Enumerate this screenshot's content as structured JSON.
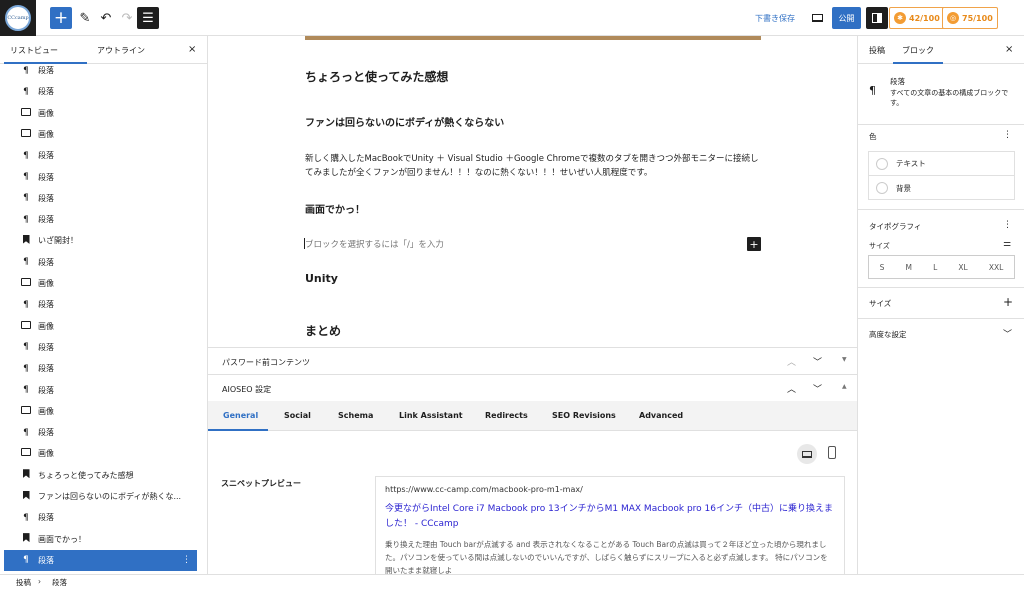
{
  "toolbar": {
    "site_logo_text": "CCcamp",
    "add_icon": "plus-icon",
    "edit_icon": "pencil-icon",
    "undo_icon": "undo-icon",
    "redo_icon": "redo-icon",
    "list_view_icon": "list-view-icon",
    "save_draft": "下書き保存",
    "preview_icon": "preview-icon",
    "publish": "公開",
    "settings_icon": "settings-icon",
    "score1": "42/100",
    "score2": "75/100"
  },
  "left_panel": {
    "tabs": [
      "リストビュー",
      "アウトライン"
    ],
    "close": "×",
    "items": [
      {
        "type": "paragraph",
        "label": "段落"
      },
      {
        "type": "paragraph",
        "label": "段落"
      },
      {
        "type": "image",
        "label": "画像"
      },
      {
        "type": "image",
        "label": "画像"
      },
      {
        "type": "paragraph",
        "label": "段落"
      },
      {
        "type": "paragraph",
        "label": "段落"
      },
      {
        "type": "paragraph",
        "label": "段落"
      },
      {
        "type": "paragraph",
        "label": "段落"
      },
      {
        "type": "heading",
        "label": "いざ開封！"
      },
      {
        "type": "paragraph",
        "label": "段落"
      },
      {
        "type": "image",
        "label": "画像"
      },
      {
        "type": "paragraph",
        "label": "段落"
      },
      {
        "type": "image",
        "label": "画像"
      },
      {
        "type": "paragraph",
        "label": "段落"
      },
      {
        "type": "paragraph",
        "label": "段落"
      },
      {
        "type": "paragraph",
        "label": "段落"
      },
      {
        "type": "image",
        "label": "画像"
      },
      {
        "type": "paragraph",
        "label": "段落"
      },
      {
        "type": "image",
        "label": "画像"
      },
      {
        "type": "heading",
        "label": "ちょろっと使ってみた感想"
      },
      {
        "type": "heading",
        "label": "ファンは回らないのにボディが熱くな..."
      },
      {
        "type": "paragraph",
        "label": "段落"
      },
      {
        "type": "heading",
        "label": "画面でかっ！"
      },
      {
        "type": "paragraph",
        "label": "段落",
        "selected": true
      }
    ]
  },
  "editor": {
    "h2_impressions": "ちょろっと使ってみた感想",
    "h3_fan": "ファンは回らないのにボディが熱くならない",
    "para1": "新しく購入したMacBookでUnity ＋ Visual Studio ＋Google Chromeで複数のタブを開きつつ外部モニターに接続してみましたが全くファンが回りません！！！なのに熱くない！！！せいぜい人肌程度です。",
    "h3_screen": "画面でかっ！",
    "placeholder": "ブロックを選択するには「/」を入力",
    "h3_unity": "Unity",
    "h2_summary": "まとめ"
  },
  "metaboxes": {
    "password": "パスワード前コンテンツ",
    "aioseo": "AIOSEO 設定"
  },
  "aioseo": {
    "tabs": [
      "General",
      "Social",
      "Schema",
      "Link Assistant",
      "Redirects",
      "SEO Revisions",
      "Advanced"
    ],
    "snippet_label": "スニペットプレビュー",
    "snippet_url": "https://www.cc-camp.com/macbook-pro-m1-max/",
    "snippet_title": "今更ながらIntel Core i7 Macbook pro 13インチからM1 MAX Macbook pro 16インチ（中古）に乗り換えました！ - CCcamp",
    "snippet_desc": "乗り換えた理由 Touch barが点滅する and 表示されなくなることがある Touch Barの点滅は買って２年ほど立った頃から現れました。パソコンを使っている間は点滅しないのでいいんですが、しばらく触らずにスリープに入ると必ず点滅します。 特にパソコンを開いたまま就寝しよ"
  },
  "right_panel": {
    "tabs": [
      "投稿",
      "ブロック"
    ],
    "close": "×",
    "block_name": "段落",
    "block_desc": "すべての文章の基本の構成ブロックです。",
    "color_title": "色",
    "color_text": "テキスト",
    "color_bg": "背景",
    "typo_title": "タイポグラフィ",
    "size_label": "サイズ",
    "sizes": [
      "S",
      "M",
      "L",
      "XL",
      "XXL"
    ],
    "size_section": "サイズ",
    "advanced": "高度な設定"
  },
  "breadcrumb": {
    "post": "投稿",
    "sep": "›",
    "block": "段落"
  }
}
